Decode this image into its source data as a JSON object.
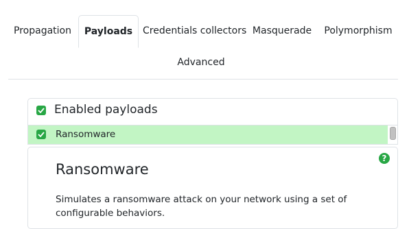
{
  "tabs": [
    {
      "label": "Propagation",
      "active": false
    },
    {
      "label": "Payloads",
      "active": true
    },
    {
      "label": "Credentials collectors",
      "active": false
    },
    {
      "label": "Masquerade",
      "active": false
    },
    {
      "label": "Polymorphism",
      "active": false
    },
    {
      "label": "Advanced",
      "active": false
    }
  ],
  "panel": {
    "title": "Enabled payloads",
    "checked": true
  },
  "list": [
    {
      "label": "Ransomware",
      "checked": true,
      "selected": true
    }
  ],
  "details": {
    "title": "Ransomware",
    "description": "Simulates a ransomware attack on your network using a set of configurable behaviors.",
    "help_glyph": "?"
  },
  "colors": {
    "accent_green": "#28a745",
    "selected_row": "#c2f5c4",
    "border": "#dee2e6"
  },
  "icons": {
    "checkbox": "check-icon",
    "help": "question-circle-icon"
  }
}
